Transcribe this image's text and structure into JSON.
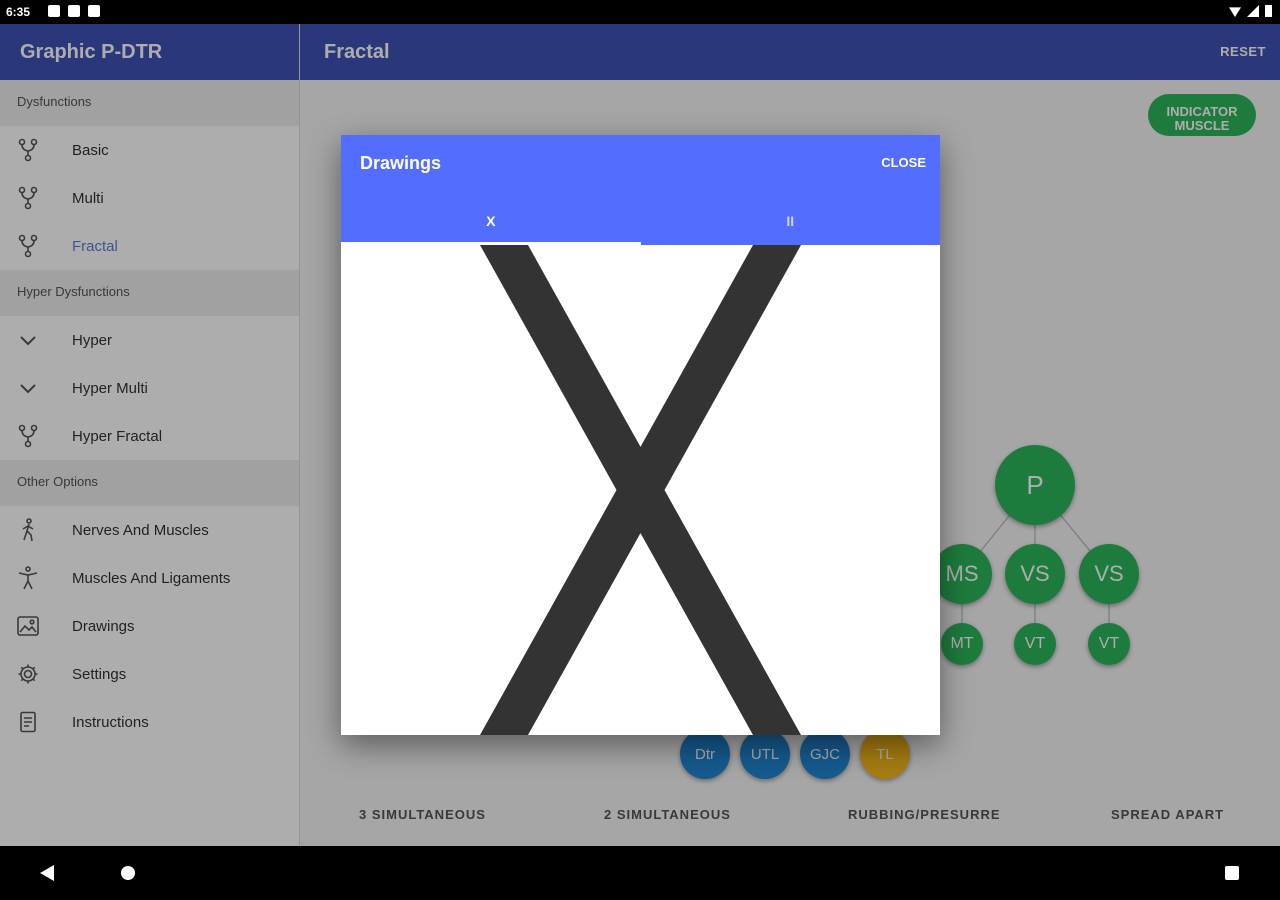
{
  "status": {
    "time": "6:35"
  },
  "sidebar": {
    "title": "Graphic P-DTR",
    "sections": [
      {
        "header": "Dysfunctions",
        "items": [
          {
            "label": "Basic",
            "icon": "fork-icon"
          },
          {
            "label": "Multi",
            "icon": "fork-icon"
          },
          {
            "label": "Fractal",
            "icon": "fork-icon",
            "active": true
          }
        ]
      },
      {
        "header": "Hyper Dysfunctions",
        "items": [
          {
            "label": "Hyper",
            "icon": "chevron-down-icon"
          },
          {
            "label": "Hyper Multi",
            "icon": "chevron-down-icon"
          },
          {
            "label": "Hyper Fractal",
            "icon": "fork-icon"
          }
        ]
      },
      {
        "header": "Other Options",
        "items": [
          {
            "label": "Nerves And Muscles",
            "icon": "walking-person-icon"
          },
          {
            "label": "Muscles And Ligaments",
            "icon": "person-icon"
          },
          {
            "label": "Drawings",
            "icon": "image-icon"
          },
          {
            "label": "Settings",
            "icon": "gear-icon"
          },
          {
            "label": "Instructions",
            "icon": "document-icon"
          }
        ]
      }
    ]
  },
  "toolbar": {
    "title": "Fractal",
    "reset_label": "RESET"
  },
  "main": {
    "indicator_label_line1": "INDICATOR",
    "indicator_label_line2": "MUSCLE",
    "nodes": {
      "p": "P",
      "ms": "MS",
      "vs1": "VS",
      "vs2": "VS",
      "mt": "MT",
      "vt1": "VT",
      "vt2": "VT",
      "dtr": "Dtr",
      "utl": "UTL",
      "gjc": "GJC",
      "tl": "TL"
    },
    "actions": [
      "3 SIMULTANEOUS",
      "2 SIMULTANEOUS",
      "RUBBING/PRESURRE",
      "SPREAD APART"
    ],
    "colors": {
      "green": "#2bb75a",
      "blue": "#1f86d3",
      "yellow": "#f5b91a",
      "indigo": "#3f51b5"
    }
  },
  "dialog": {
    "title": "Drawings",
    "close_label": "CLOSE",
    "tabs": [
      "X",
      "II"
    ],
    "active_tab": 0,
    "drawing": "X",
    "header_color": "#536dfe"
  }
}
